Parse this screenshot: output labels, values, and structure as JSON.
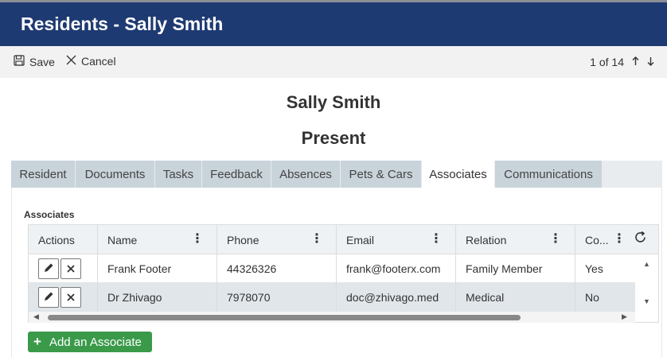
{
  "header": {
    "title": "Residents - Sally Smith"
  },
  "toolbar": {
    "save_label": "Save",
    "cancel_label": "Cancel",
    "pager_text": "1 of 14"
  },
  "record": {
    "name": "Sally Smith",
    "status": "Present"
  },
  "tabs": [
    {
      "label": "Resident"
    },
    {
      "label": "Documents"
    },
    {
      "label": "Tasks"
    },
    {
      "label": "Feedback"
    },
    {
      "label": "Absences"
    },
    {
      "label": "Pets & Cars"
    },
    {
      "label": "Associates",
      "active": true
    },
    {
      "label": "Communications"
    }
  ],
  "associates": {
    "section_label": "Associates",
    "columns": [
      "Actions",
      "Name",
      "Phone",
      "Email",
      "Relation",
      "Co..."
    ],
    "rows": [
      {
        "name": "Frank Footer",
        "phone": "44326326",
        "email": "frank@footerx.com",
        "relation": "Family Member",
        "co": "Yes"
      },
      {
        "name": "Dr Zhivago",
        "phone": "7978070",
        "email": "doc@zhivago.med",
        "relation": "Medical",
        "co": "No"
      }
    ],
    "add_label": "Add an Associate"
  },
  "colors": {
    "titlebar": "#1e3a72",
    "tab_inactive": "#c9d3da",
    "add_button": "#3a9a4a"
  },
  "icons": [
    "save-icon",
    "close-icon",
    "arrow-up-icon",
    "arrow-down-icon",
    "kebab-icon",
    "refresh-icon",
    "pencil-icon",
    "plus-icon"
  ]
}
